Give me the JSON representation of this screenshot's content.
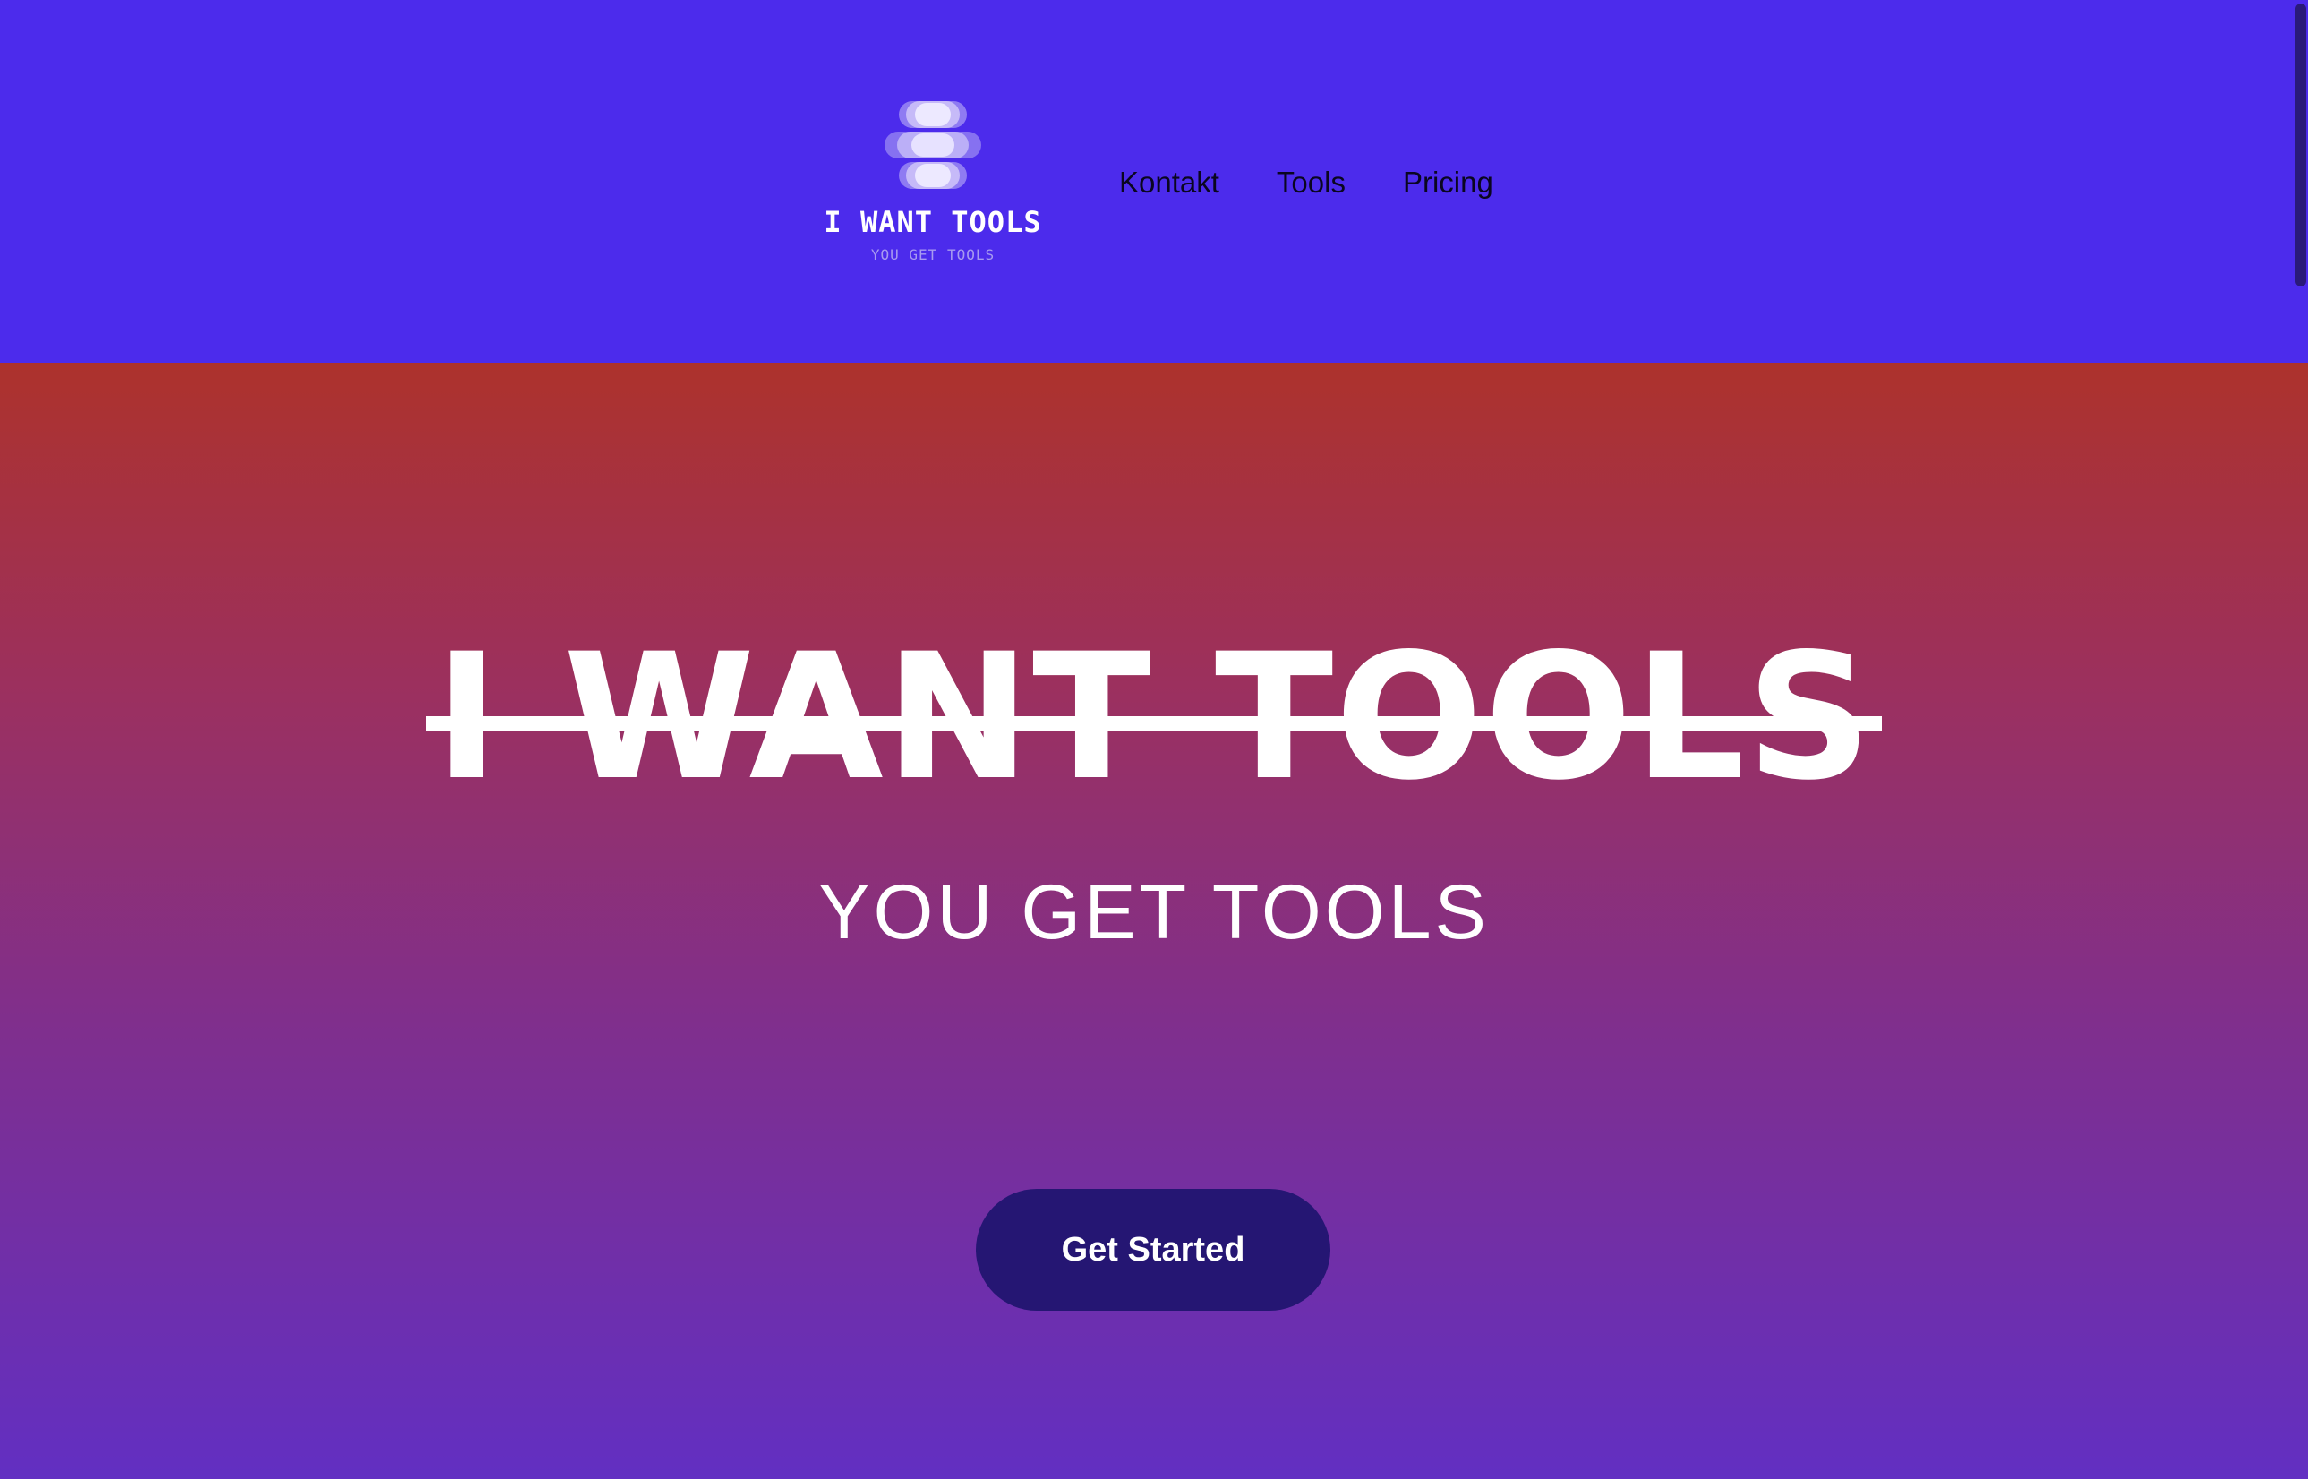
{
  "colors": {
    "header_bg": "#4c2bec",
    "hero_gradient_top": "#ad322c",
    "hero_gradient_bottom": "#622fc2",
    "button_bg": "#251673",
    "text_light": "#ffffff",
    "nav_text": "#0a0620"
  },
  "header": {
    "logo": {
      "icon": "stacked-pills-logo-icon",
      "title": "I WANT TOOLS",
      "subtitle": "YOU GET TOOLS"
    },
    "nav": [
      {
        "label": "Kontakt"
      },
      {
        "label": "Tools"
      },
      {
        "label": "Pricing"
      }
    ]
  },
  "hero": {
    "title": "I WANT TOOLS",
    "subtitle": "YOU GET TOOLS",
    "cta_label": "Get Started"
  }
}
